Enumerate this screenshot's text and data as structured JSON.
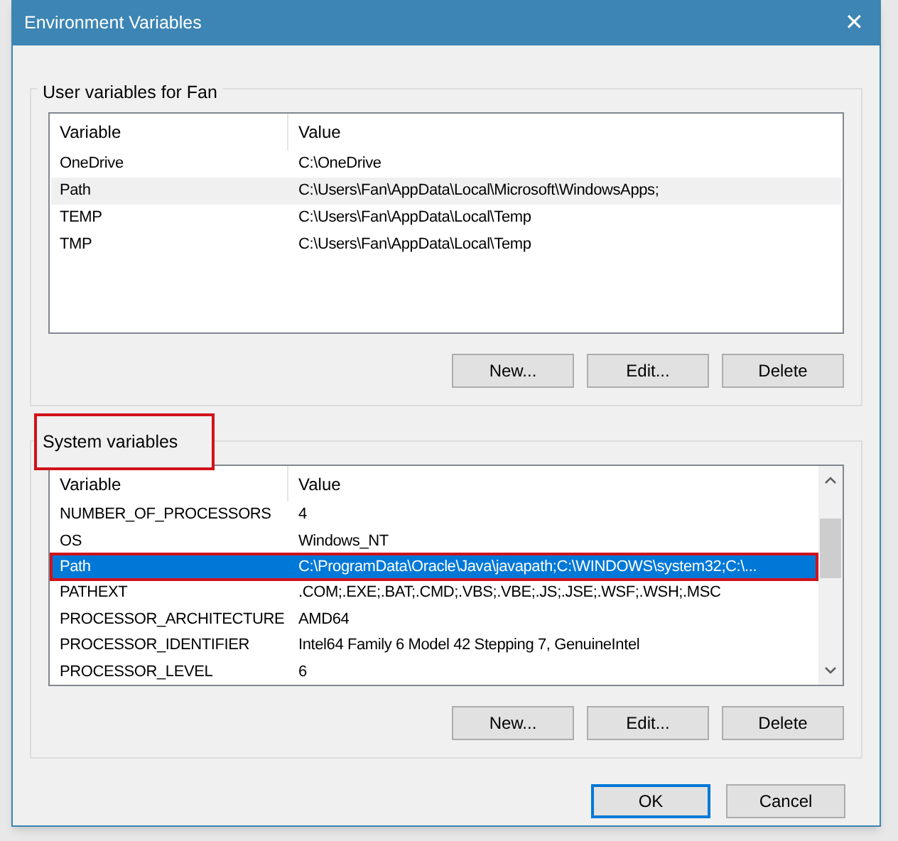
{
  "window": {
    "title": "Environment Variables",
    "close": "✕"
  },
  "user_section": {
    "title": "User variables for Fan",
    "highlighted": false,
    "columns": [
      "Variable",
      "Value"
    ],
    "rows": [
      {
        "variable": "OneDrive",
        "value": "C:\\OneDrive",
        "selected": false,
        "highlighted": false,
        "hovered": false
      },
      {
        "variable": "Path",
        "value": "C:\\Users\\Fan\\AppData\\Local\\Microsoft\\WindowsApps;",
        "selected": false,
        "highlighted": false,
        "hovered": true
      },
      {
        "variable": "TEMP",
        "value": "C:\\Users\\Fan\\AppData\\Local\\Temp",
        "selected": false,
        "highlighted": false,
        "hovered": false
      },
      {
        "variable": "TMP",
        "value": "C:\\Users\\Fan\\AppData\\Local\\Temp",
        "selected": false,
        "highlighted": false,
        "hovered": false
      }
    ],
    "buttons": [
      "New...",
      "Edit...",
      "Delete"
    ],
    "scrollbar": false
  },
  "system_section": {
    "title": "System variables",
    "highlighted": true,
    "columns": [
      "Variable",
      "Value"
    ],
    "rows": [
      {
        "variable": "NUMBER_OF_PROCESSORS",
        "value": "4",
        "selected": false,
        "highlighted": false,
        "hovered": false
      },
      {
        "variable": "OS",
        "value": "Windows_NT",
        "selected": false,
        "highlighted": false,
        "hovered": false
      },
      {
        "variable": "Path",
        "value": "C:\\ProgramData\\Oracle\\Java\\javapath;C:\\WINDOWS\\system32;C:\\...",
        "selected": true,
        "highlighted": true
      },
      {
        "variable": "PATHEXT",
        "value": ".COM;.EXE;.BAT;.CMD;.VBS;.VBE;.JS;.JSE;.WSF;.WSH;.MSC",
        "selected": false,
        "highlighted": false,
        "hovered": false
      },
      {
        "variable": "PROCESSOR_ARCHITECTURE",
        "value": "AMD64",
        "selected": false,
        "highlighted": false,
        "hovered": false
      },
      {
        "variable": "PROCESSOR_IDENTIFIER",
        "value": "Intel64 Family 6 Model 42 Stepping 7, GenuineIntel",
        "selected": false,
        "highlighted": false,
        "hovered": false
      },
      {
        "variable": "PROCESSOR_LEVEL",
        "value": "6",
        "selected": false,
        "highlighted": false,
        "hovered": false
      }
    ],
    "buttons": [
      "New...",
      "Edit...",
      "Delete"
    ],
    "scrollbar": true
  },
  "dialog_buttons": [
    {
      "label": "OK",
      "default": true
    },
    {
      "label": "Cancel",
      "default": false
    }
  ]
}
